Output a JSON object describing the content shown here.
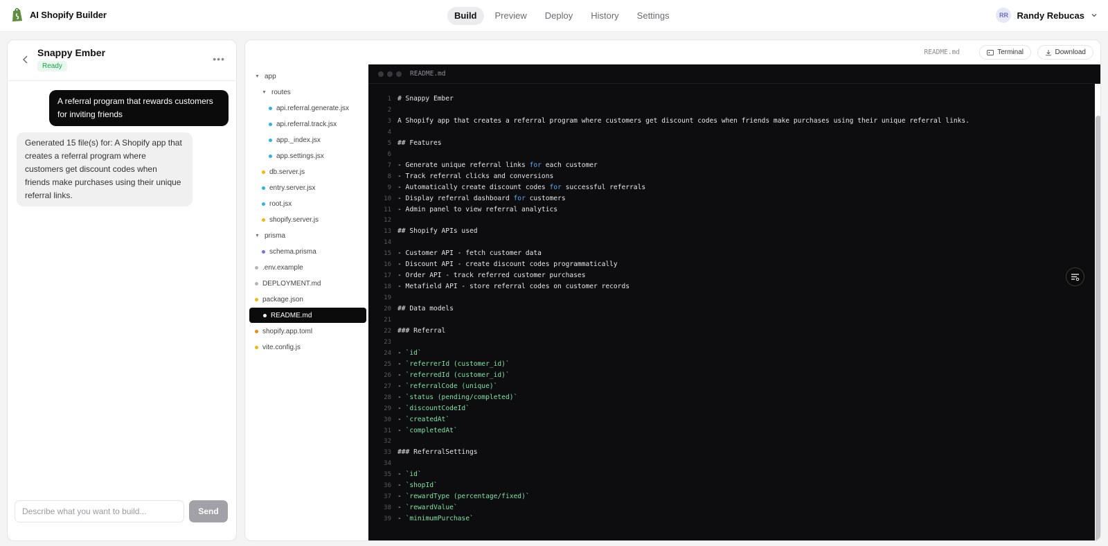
{
  "app": {
    "name": "AI Shopify Builder"
  },
  "nav": {
    "tabs": [
      {
        "label": "Build",
        "active": true
      },
      {
        "label": "Preview",
        "active": false
      },
      {
        "label": "Deploy",
        "active": false
      },
      {
        "label": "History",
        "active": false
      },
      {
        "label": "Settings",
        "active": false
      }
    ]
  },
  "user": {
    "initials": "RR",
    "name": "Randy Rebucas"
  },
  "chat": {
    "project_title": "Snappy Ember",
    "status": "Ready",
    "messages": [
      {
        "role": "user",
        "text": "A referral program that rewards customers for inviting friends"
      },
      {
        "role": "assistant",
        "text": "Generated 15 file(s) for: A Shopify app that creates a referral program where customers get discount codes when friends make purchases using their unique referral links."
      }
    ],
    "input_value": "",
    "input_placeholder": "Describe what you want to build...",
    "send_label": "Send"
  },
  "toolbar": {
    "current_file": "README.md",
    "terminal_label": "Terminal",
    "download_label": "Download"
  },
  "file_tree": [
    {
      "name": "app",
      "type": "folder",
      "depth": 0
    },
    {
      "name": "routes",
      "type": "folder",
      "depth": 1
    },
    {
      "name": "api.referral.generate.jsx",
      "type": "file",
      "depth": 2,
      "color": "#2bb3e6"
    },
    {
      "name": "api.referral.track.jsx",
      "type": "file",
      "depth": 2,
      "color": "#2bb3e6"
    },
    {
      "name": "app._index.jsx",
      "type": "file",
      "depth": 2,
      "color": "#2bb3e6"
    },
    {
      "name": "app.settings.jsx",
      "type": "file",
      "depth": 2,
      "color": "#2bb3e6"
    },
    {
      "name": "db.server.js",
      "type": "file",
      "depth": 1,
      "color": "#f2b807"
    },
    {
      "name": "entry.server.jsx",
      "type": "file",
      "depth": 1,
      "color": "#2bb3e6"
    },
    {
      "name": "root.jsx",
      "type": "file",
      "depth": 1,
      "color": "#2bb3e6"
    },
    {
      "name": "shopify.server.js",
      "type": "file",
      "depth": 1,
      "color": "#f2b807"
    },
    {
      "name": "prisma",
      "type": "folder",
      "depth": 0
    },
    {
      "name": "schema.prisma",
      "type": "file",
      "depth": 1,
      "color": "#6f76d8"
    },
    {
      "name": ".env.example",
      "type": "file",
      "depth": 0,
      "color": "#b4b4b8"
    },
    {
      "name": "DEPLOYMENT.md",
      "type": "file",
      "depth": 0,
      "color": "#b4b4b8"
    },
    {
      "name": "package.json",
      "type": "file",
      "depth": 0,
      "color": "#f2b807"
    },
    {
      "name": "README.md",
      "type": "file",
      "depth": 0,
      "color": "#ffffff",
      "selected": true
    },
    {
      "name": "shopify.app.toml",
      "type": "file",
      "depth": 0,
      "color": "#ee8b0d"
    },
    {
      "name": "vite.config.js",
      "type": "file",
      "depth": 0,
      "color": "#f2b807"
    }
  ],
  "editor": {
    "title": "README.md",
    "lines": [
      "# Snappy Ember",
      "",
      "A Shopify app that creates a referral program where customers get discount codes when friends make purchases using their unique referral links.",
      "",
      "## Features",
      "",
      "- Generate unique referral links for each customer",
      "- Track referral clicks and conversions",
      "- Automatically create discount codes for successful referrals",
      "- Display referral dashboard for customers",
      "- Admin panel to view referral analytics",
      "",
      "## Shopify APIs used",
      "",
      "- Customer API - fetch customer data",
      "- Discount API - create discount codes programmatically",
      "- Order API - track referred customer purchases",
      "- Metafield API - store referral codes on customer records",
      "",
      "## Data models",
      "",
      "### Referral",
      "",
      "- `id`",
      "- `referrerId (customer_id)`",
      "- `referredId (customer_id)`",
      "- `referralCode (unique)`",
      "- `status (pending/completed)`",
      "- `discountCodeId`",
      "- `createdAt`",
      "- `completedAt`",
      "",
      "### ReferralSettings",
      "",
      "- `id`",
      "- `shopId`",
      "- `rewardType (percentage/fixed)`",
      "- `rewardValue`",
      "- `minimumPurchase`"
    ]
  }
}
